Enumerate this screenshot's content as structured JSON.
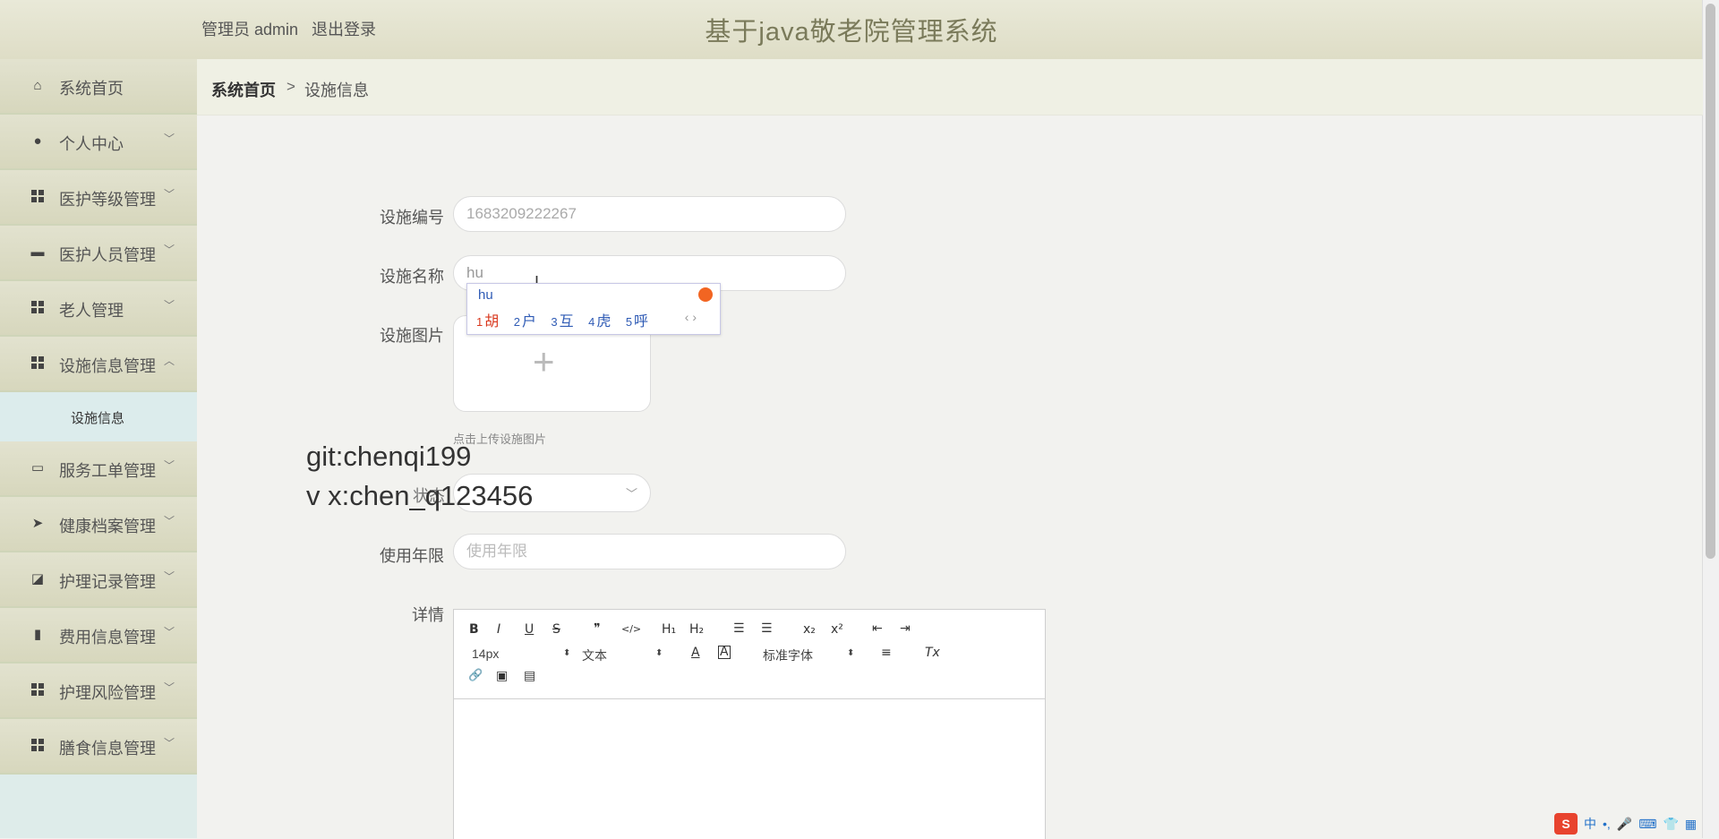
{
  "header": {
    "user_role": "管理员 admin",
    "logout": "退出登录",
    "title": "基于java敬老院管理系统"
  },
  "sidebar": {
    "items": [
      {
        "label": "系统首页",
        "icon": "home-icon",
        "has_arrow": false
      },
      {
        "label": "个人中心",
        "icon": "user-icon",
        "arrow": "﹀"
      },
      {
        "label": "医护等级管理",
        "icon": "grid-icon",
        "arrow": "﹀"
      },
      {
        "label": "医护人员管理",
        "icon": "comment-icon",
        "arrow": "﹀"
      },
      {
        "label": "老人管理",
        "icon": "grid-icon",
        "arrow": "﹀"
      },
      {
        "label": "设施信息管理",
        "icon": "grid-icon",
        "arrow": "︿",
        "expanded": true
      },
      {
        "label": "服务工单管理",
        "icon": "monitor-icon",
        "arrow": "﹀"
      },
      {
        "label": "健康档案管理",
        "icon": "send-icon",
        "arrow": "﹀"
      },
      {
        "label": "护理记录管理",
        "icon": "chart-icon",
        "arrow": "﹀"
      },
      {
        "label": "费用信息管理",
        "icon": "book-icon",
        "arrow": "﹀"
      },
      {
        "label": "护理风险管理",
        "icon": "grid-icon",
        "arrow": "﹀"
      },
      {
        "label": "膳食信息管理",
        "icon": "grid-icon",
        "arrow": "﹀"
      }
    ],
    "sub_item": "设施信息"
  },
  "breadcrumb": {
    "home": "系统首页",
    "separator": ">",
    "current": "设施信息"
  },
  "form": {
    "code_label": "设施编号",
    "code_value": "1683209222267",
    "name_label": "设施名称",
    "name_value": "hu",
    "image_label": "设施图片",
    "upload_plus": "+",
    "upload_tip": "点击上传设施图片",
    "status_label": "状态",
    "status_arrow": "﹀",
    "years_label": "使用年限",
    "years_placeholder": "使用年限",
    "detail_label": "详情"
  },
  "watermark": {
    "line1": "git:chenqi199",
    "line2": "v x:chen_q123456"
  },
  "ime": {
    "typed": "hu",
    "candidates": [
      {
        "num": "1",
        "char": "胡"
      },
      {
        "num": "2",
        "char": "户"
      },
      {
        "num": "3",
        "char": "互"
      },
      {
        "num": "4",
        "char": "虎"
      },
      {
        "num": "5",
        "char": "呼"
      }
    ],
    "nav": "‹ ›"
  },
  "editor": {
    "font_size": "14px",
    "text_type": "文本",
    "font_family": "标准字体",
    "buttons": {
      "bold": "B",
      "italic": "I",
      "underline": "U",
      "strike": "S",
      "quote": "❞",
      "code": "</>",
      "h1": "H₁",
      "h2": "H₂",
      "ol": "☰",
      "ul": "☰",
      "sub": "x₂",
      "sup": "x²",
      "outdent": "⇤",
      "indent": "⇥",
      "color": "A",
      "bg": "A",
      "align": "≡",
      "clean": "Tx",
      "link": "🔗",
      "image": "▣",
      "video": "▤"
    }
  },
  "tray": {
    "logo": "S",
    "lang": "中",
    "punct": "•,",
    "mic": "🎤",
    "keyboard": "⌨",
    "skin": "👕",
    "menu": "▦"
  }
}
